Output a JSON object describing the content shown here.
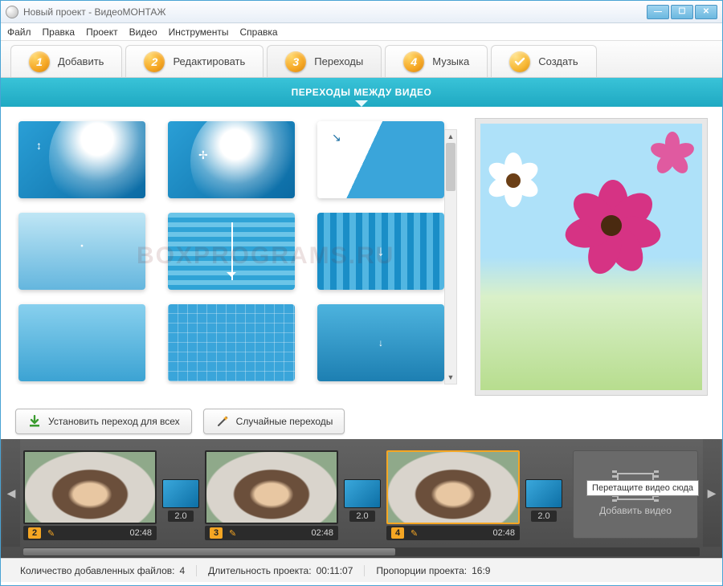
{
  "window": {
    "title": "Новый проект - ВидеоМОНТАЖ"
  },
  "menu": [
    "Файл",
    "Правка",
    "Проект",
    "Видео",
    "Инструменты",
    "Справка"
  ],
  "tabs": [
    {
      "num": "1",
      "label": "Добавить"
    },
    {
      "num": "2",
      "label": "Редактировать"
    },
    {
      "num": "3",
      "label": "Переходы",
      "active": true
    },
    {
      "num": "4",
      "label": "Музыка"
    },
    {
      "num": "✓",
      "label": "Создать",
      "check": true
    }
  ],
  "banner": "ПЕРЕХОДЫ МЕЖДУ ВИДЕО",
  "buttons": {
    "apply_all": "Установить переход для всех",
    "random": "Случайные переходы"
  },
  "timeline": {
    "clips": [
      {
        "num": "2",
        "dur": "02:48"
      },
      {
        "num": "3",
        "dur": "02:48"
      },
      {
        "num": "4",
        "dur": "02:48",
        "selected": true
      }
    ],
    "trans_value": "2.0",
    "drop_tooltip": "Перетащите видео сюда",
    "drop_label": "Добавить видео"
  },
  "status": {
    "files_label": "Количество добавленных файлов:",
    "files_value": "4",
    "duration_label": "Длительность проекта:",
    "duration_value": "00:11:07",
    "ratio_label": "Пропорции проекта:",
    "ratio_value": "16:9"
  },
  "watermark": "BOXPROGRAMS.RU"
}
